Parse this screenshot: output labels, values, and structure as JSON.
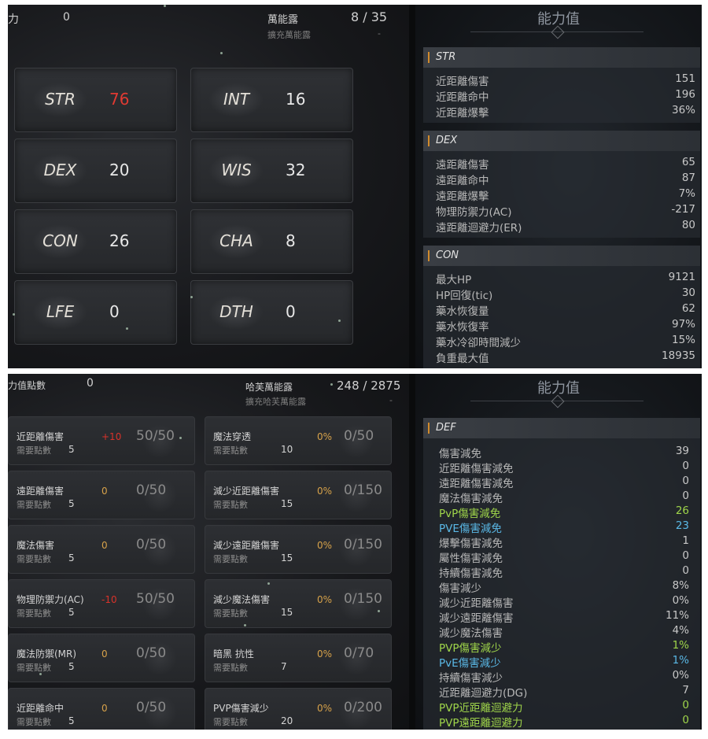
{
  "top_panel": {
    "header": {
      "points_value": "0",
      "points_label_partial": "力",
      "rune_label": "萬能露",
      "rune_count": "8 / 35",
      "rune_expand": "擴充萬能露",
      "rune_expand_value": "-"
    },
    "stats": [
      {
        "name": "STR",
        "value": "76",
        "highlight": "red"
      },
      {
        "name": "INT",
        "value": "16"
      },
      {
        "name": "DEX",
        "value": "20"
      },
      {
        "name": "WIS",
        "value": "32"
      },
      {
        "name": "CON",
        "value": "26"
      },
      {
        "name": "CHA",
        "value": "8"
      },
      {
        "name": "LFE",
        "value": "0"
      },
      {
        "name": "DTH",
        "value": "0"
      }
    ],
    "abilities": {
      "title": "能力值",
      "sections": [
        {
          "name": "STR",
          "rows": [
            {
              "label": "近距離傷害",
              "value": "151"
            },
            {
              "label": "近距離命中",
              "value": "196"
            },
            {
              "label": "近距離爆擊",
              "value": "36%"
            }
          ]
        },
        {
          "name": "DEX",
          "rows": [
            {
              "label": "遠距離傷害",
              "value": "65"
            },
            {
              "label": "遠距離命中",
              "value": "87"
            },
            {
              "label": "遠距離爆擊",
              "value": "7%"
            },
            {
              "label": "物理防禦力(AC)",
              "value": "-217"
            },
            {
              "label": "遠距離迴避力(ER)",
              "value": "80"
            }
          ]
        },
        {
          "name": "CON",
          "rows": [
            {
              "label": "最大HP",
              "value": "9121"
            },
            {
              "label": "HP回復(tic)",
              "value": "30"
            },
            {
              "label": "藥水恢復量",
              "value": "62"
            },
            {
              "label": "藥水恢復率",
              "value": "97%"
            },
            {
              "label": "藥水冷卻時間減少",
              "value": "15%"
            },
            {
              "label": "負重最大值",
              "value": "18935"
            }
          ]
        }
      ]
    }
  },
  "bottom_panel": {
    "header": {
      "points_label_partial": "力值點數",
      "points_value": "0",
      "rune_label": "哈芙萬能露",
      "rune_count": "248 / 2875",
      "rune_expand": "擴充哈芙萬能露",
      "rune_expand_value": "-"
    },
    "required_label": "需要點數",
    "skills_left": [
      {
        "name": "近距離傷害",
        "required": "5",
        "bonus": "+10",
        "bonus_color": "red",
        "progress": "50/50"
      },
      {
        "name": "遠距離傷害",
        "required": "5",
        "bonus": "0",
        "progress": "0/50"
      },
      {
        "name": "魔法傷害",
        "required": "5",
        "bonus": "0",
        "progress": "0/50"
      },
      {
        "name": "物理防禦力(AC)",
        "required": "5",
        "bonus": "-10",
        "bonus_color": "red",
        "progress": "50/50"
      },
      {
        "name": "魔法防禦(MR)",
        "required": "5",
        "bonus": "0",
        "progress": "0/50"
      },
      {
        "name": "近距離命中",
        "required": "5",
        "bonus": "0",
        "progress": "0/50"
      }
    ],
    "skills_right": [
      {
        "name": "魔法穿透",
        "required": "10",
        "bonus": "0%",
        "progress": "0/50"
      },
      {
        "name": "減少近距離傷害",
        "required": "15",
        "bonus": "0%",
        "progress": "0/150"
      },
      {
        "name": "減少遠距離傷害",
        "required": "15",
        "bonus": "0%",
        "progress": "0/150"
      },
      {
        "name": "減少魔法傷害",
        "required": "15",
        "bonus": "0%",
        "progress": "0/150"
      },
      {
        "name": "暗黑 抗性",
        "required": "7",
        "bonus": "0%",
        "progress": "0/70"
      },
      {
        "name": "PVP傷害減少",
        "required": "20",
        "bonus": "0%",
        "progress": "0/200"
      }
    ],
    "abilities": {
      "title": "能力值",
      "section_name": "DEF",
      "rows": [
        {
          "label": "傷害減免",
          "value": "39"
        },
        {
          "label": "近距離傷害減免",
          "value": "0"
        },
        {
          "label": "遠距離傷害減免",
          "value": "0"
        },
        {
          "label": "魔法傷害減免",
          "value": "0"
        },
        {
          "label": "PvP傷害減免",
          "value": "26",
          "color": "green"
        },
        {
          "label": "PVE傷害減免",
          "value": "23",
          "color": "blue"
        },
        {
          "label": "爆擊傷害減免",
          "value": "1"
        },
        {
          "label": "屬性傷害減免",
          "value": "0"
        },
        {
          "label": "持續傷害減免",
          "value": "0"
        },
        {
          "label": "傷害減少",
          "value": "8%"
        },
        {
          "label": "減少近距離傷害",
          "value": "0%"
        },
        {
          "label": "減少遠距離傷害",
          "value": "11%"
        },
        {
          "label": "減少魔法傷害",
          "value": "4%"
        },
        {
          "label": "PVP傷害減少",
          "value": "1%",
          "color": "green"
        },
        {
          "label": "PvE傷害減少",
          "value": "1%",
          "color": "blue"
        },
        {
          "label": "持續傷害減少",
          "value": "0%"
        },
        {
          "label": "近距離迴避力(DG)",
          "value": "7"
        },
        {
          "label": "PVP近距離迴避力",
          "value": "0",
          "color": "green"
        },
        {
          "label": "PVP遠距離迴避力",
          "value": "0",
          "color": "green"
        }
      ]
    }
  }
}
